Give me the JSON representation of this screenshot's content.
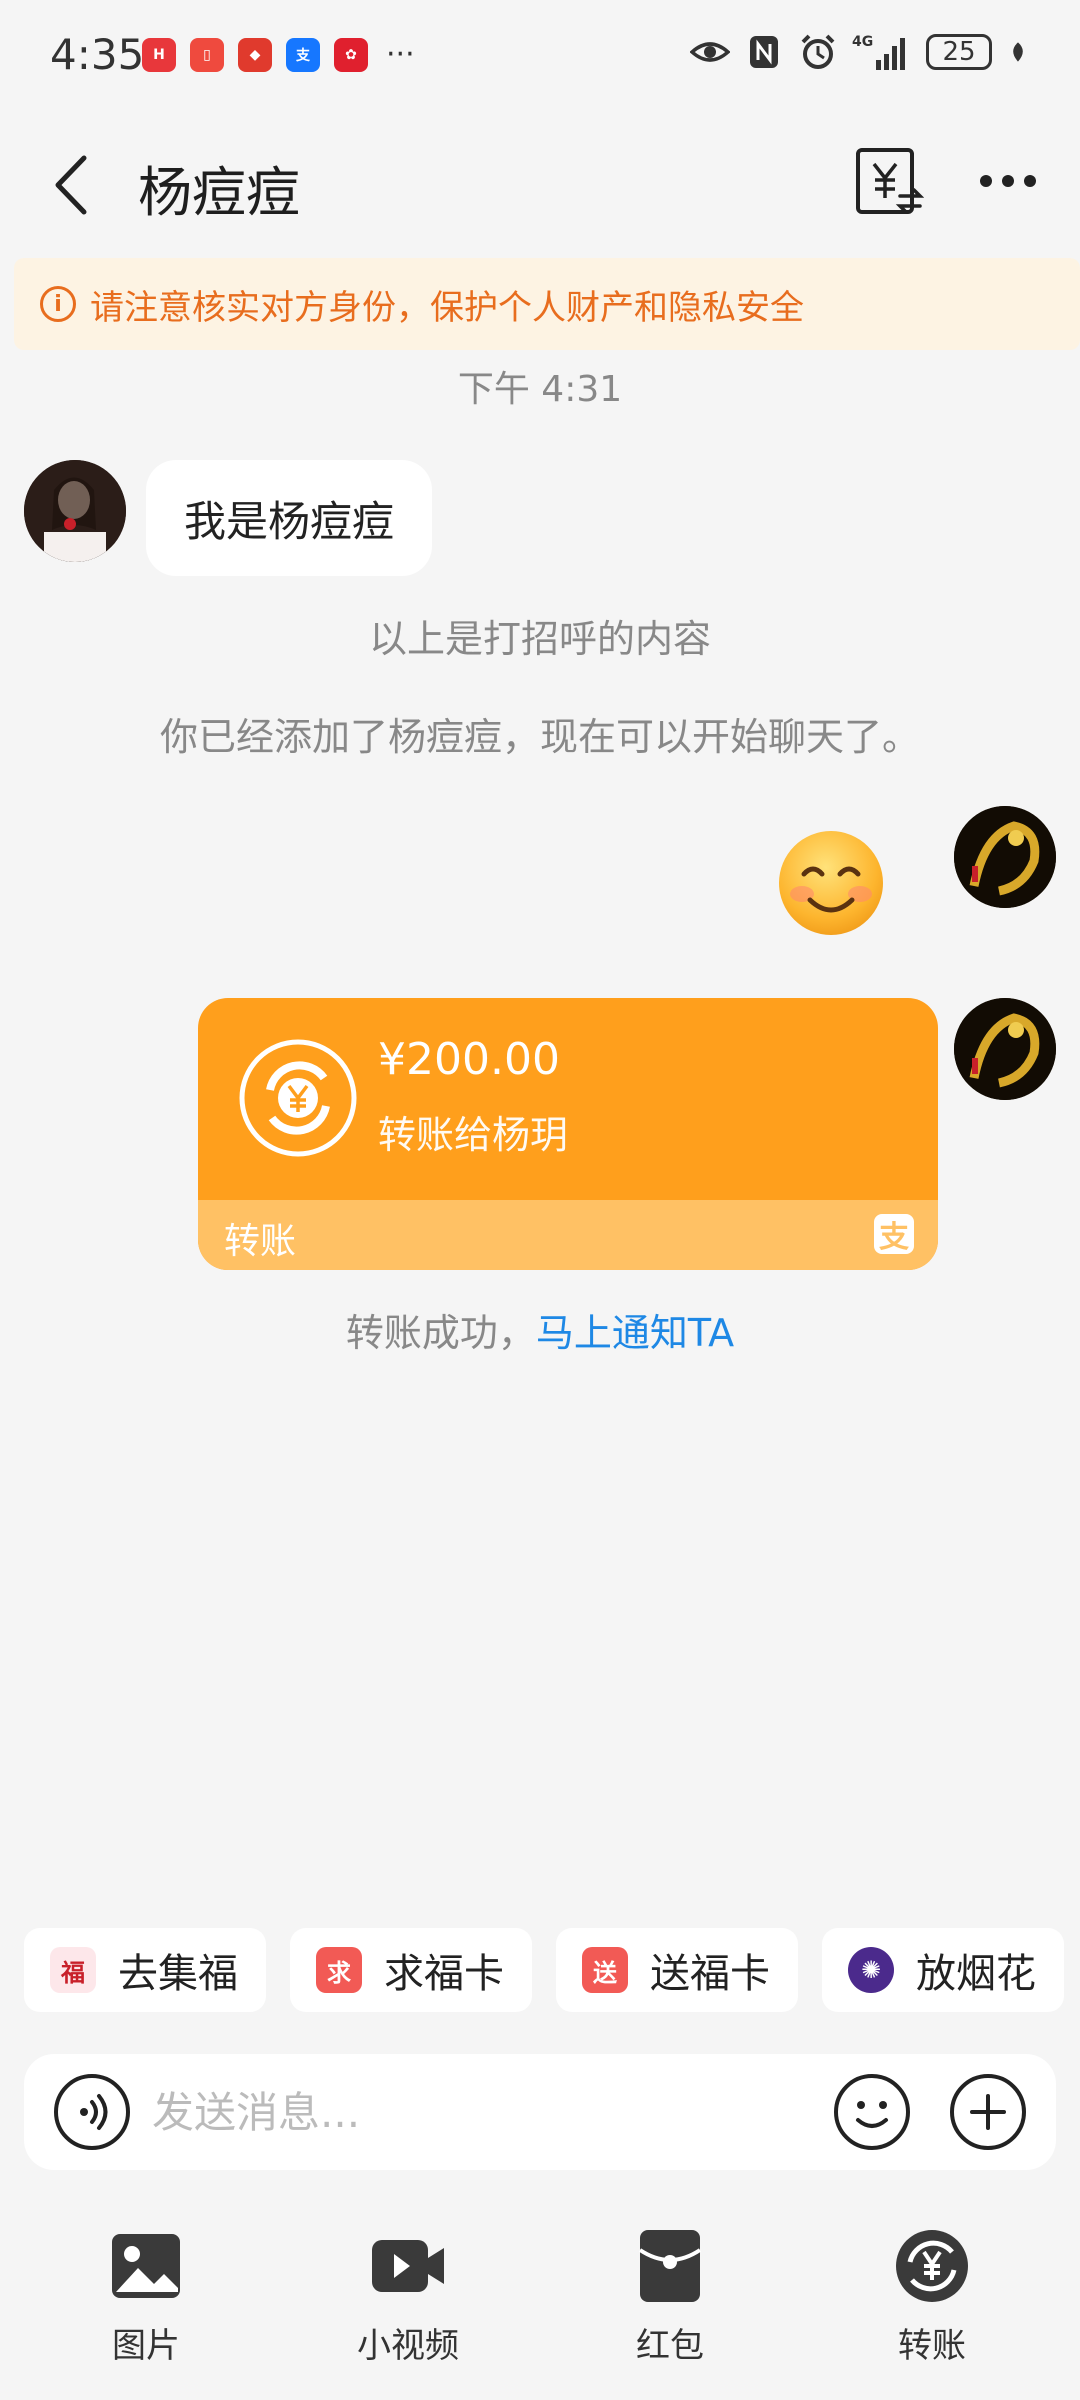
{
  "status_bar": {
    "time": "4:35",
    "more": "···",
    "network": "4G",
    "battery": "25"
  },
  "header": {
    "title": "杨痘痘"
  },
  "warning": {
    "text": "请注意核实对方身份，保护个人财产和隐私安全"
  },
  "messages": {
    "timestamp": "下午 4:31",
    "incoming_text": "我是杨痘痘",
    "system_1": "以上是打招呼的内容",
    "system_2": "你已经添加了杨痘痘，现在可以开始聊天了。"
  },
  "transfer_card": {
    "amount": "¥200.00",
    "description": "转账给杨玥",
    "footer_label": "转账",
    "status_text": "转账成功，",
    "notify_link": "马上通知TA"
  },
  "quick_actions": [
    {
      "label": "去集福",
      "icon": "fu-icon",
      "glyph": "福",
      "color": "#fde7ea"
    },
    {
      "label": "求福卡",
      "icon": "qiu-icon",
      "glyph": "求",
      "color": "#f25a55"
    },
    {
      "label": "送福卡",
      "icon": "song-icon",
      "glyph": "送",
      "color": "#f25a55"
    },
    {
      "label": "放烟花",
      "icon": "fireworks-icon",
      "glyph": "✺",
      "color": "#4b2a8c"
    }
  ],
  "input": {
    "placeholder": "发送消息..."
  },
  "toolbar": {
    "photo_label": "图片",
    "video_label": "小视频",
    "redpacket_label": "红包",
    "transfer_label": "转账"
  },
  "colors": {
    "accent": "#ff9f1c",
    "warning": "#e86d1e",
    "link": "#1e88e5",
    "background": "#f5f5f5"
  }
}
